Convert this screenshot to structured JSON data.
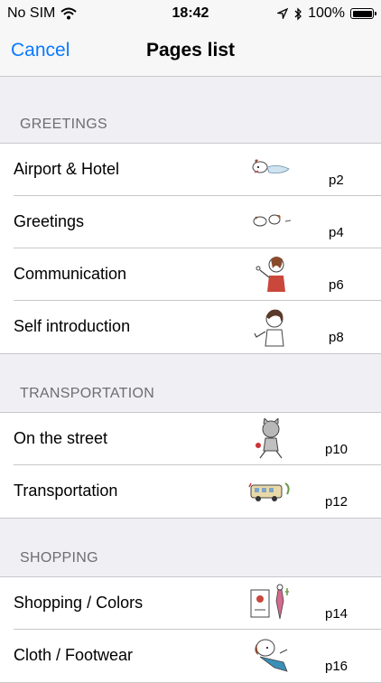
{
  "status": {
    "carrier": "No SIM",
    "time": "18:42",
    "battery": "100%"
  },
  "nav": {
    "cancel": "Cancel",
    "title": "Pages list"
  },
  "sections": [
    {
      "header": "GREETINGS",
      "rows": [
        {
          "label": "Airport & Hotel",
          "page": "p2",
          "image": "dog-lying"
        },
        {
          "label": "Greetings",
          "page": "p4",
          "image": "dogs-bowing"
        },
        {
          "label": "Communication",
          "page": "p6",
          "image": "girl-talking"
        },
        {
          "label": "Self introduction",
          "page": "p8",
          "image": "girl-pointing"
        }
      ]
    },
    {
      "header": "TRANSPORTATION",
      "rows": [
        {
          "label": "On the street",
          "page": "p10",
          "image": "cat-walking"
        },
        {
          "label": "Transportation",
          "page": "p12",
          "image": "bus"
        }
      ]
    },
    {
      "header": "SHOPPING",
      "rows": [
        {
          "label": "Shopping / Colors",
          "page": "p14",
          "image": "shop-window"
        },
        {
          "label": "Cloth / Footwear",
          "page": "p16",
          "image": "dog-scarf"
        }
      ]
    }
  ]
}
